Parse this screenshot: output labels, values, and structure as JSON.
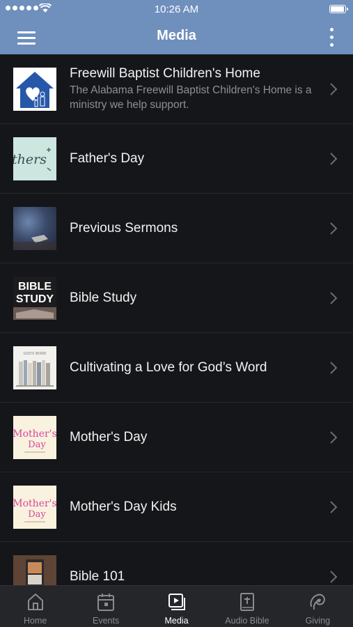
{
  "status_bar": {
    "time": "10:26 AM"
  },
  "header": {
    "title": "Media"
  },
  "items": [
    {
      "title": "Freewill Baptist Children's Home",
      "subtitle": "The Alabama Freewill Baptist Children's Home is a ministry we help support."
    },
    {
      "title": "Father's Day",
      "subtitle": ""
    },
    {
      "title": "Previous Sermons",
      "subtitle": ""
    },
    {
      "title": "Bible Study",
      "subtitle": ""
    },
    {
      "title": "Cultivating a Love for God’s Word",
      "subtitle": ""
    },
    {
      "title": "Mother's Day",
      "subtitle": ""
    },
    {
      "title": "Mother's Day Kids",
      "subtitle": ""
    },
    {
      "title": "Bible 101",
      "subtitle": ""
    }
  ],
  "thumbs": {
    "fathers_day": "thers",
    "bible_study_line1": "BIBLE",
    "bible_study_line2": "STUDY",
    "cultivating": "GOD'S WORD",
    "mothers_day_line1": "Mother's",
    "mothers_day_line2": "Day"
  },
  "tabs": [
    {
      "label": "Home",
      "icon": "home-icon"
    },
    {
      "label": "Events",
      "icon": "calendar-icon"
    },
    {
      "label": "Media",
      "icon": "media-icon",
      "active": true
    },
    {
      "label": "Audio Bible",
      "icon": "bible-icon"
    },
    {
      "label": "Giving",
      "icon": "giving-icon"
    }
  ],
  "colors": {
    "accent": "#6f8fbd",
    "background": "#151619",
    "tabbar": "#24262a"
  }
}
